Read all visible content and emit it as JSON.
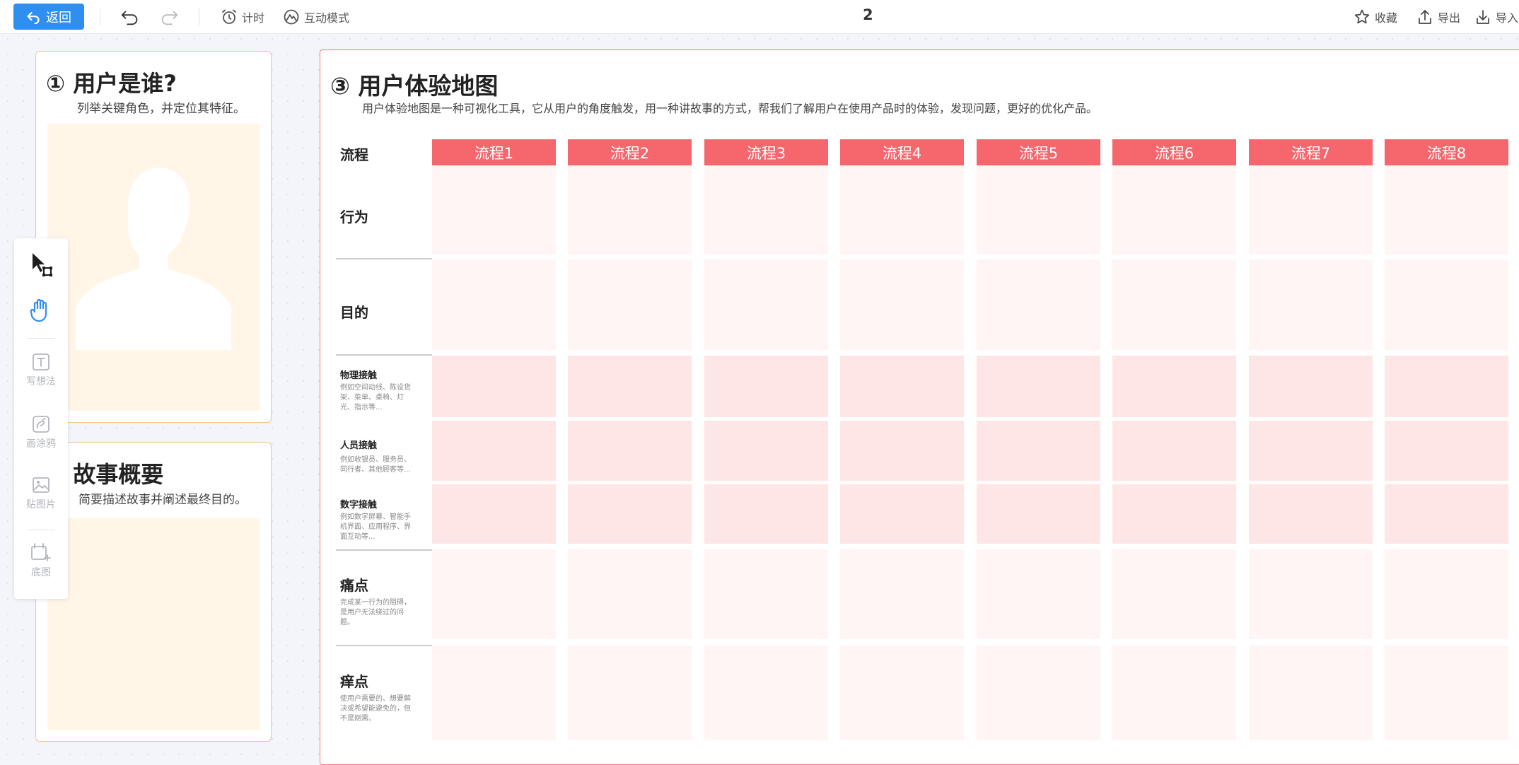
{
  "toolbar": {
    "back_label": "返回",
    "timer_label": "计时",
    "interactive_label": "互动模式",
    "page_number": "2",
    "favorite_label": "收藏",
    "export_label": "导出",
    "import_label": "导入"
  },
  "card_users": {
    "title": "① 用户是谁?",
    "subtitle": "列举关键角色，并定位其特征。"
  },
  "card_story": {
    "title": "② 故事概要",
    "subtitle": "简要描述故事并阐述最终目的。"
  },
  "palette": {
    "tools": [
      {
        "name": "select-tool",
        "label": ""
      },
      {
        "name": "hand-tool",
        "label": ""
      },
      {
        "name": "sticky-note-tool",
        "label": "写想法"
      },
      {
        "name": "doodle-tool",
        "label": "画涂鸦"
      },
      {
        "name": "image-tool",
        "label": "贴图片"
      },
      {
        "name": "background-tool",
        "label": "底图"
      }
    ]
  },
  "map": {
    "title": "③ 用户体验地图",
    "subtitle": "用户体验地图是一种可视化工具，它从用户的角度触发，用一种讲故事的方式，帮我们了解用户在使用产品时的体验，发现问题，更好的优化产品。",
    "process_label": "流程",
    "columns": [
      "流程1",
      "流程2",
      "流程3",
      "流程4",
      "流程5",
      "流程6",
      "流程7",
      "流程8"
    ],
    "rows": [
      {
        "label": "行为",
        "desc": ""
      },
      {
        "label": "目的",
        "desc": ""
      },
      {
        "label": "物理接触",
        "desc": "例如空间动线、陈设货架、菜单、桌椅、灯光、指示等..."
      },
      {
        "label": "人员接触",
        "desc": "例如收银员、服务员、同行者、其他顾客等..."
      },
      {
        "label": "数字接触",
        "desc": "例如数字屏幕、智能手机界面、应用程序、界面互动等..."
      },
      {
        "label": "痛点",
        "desc": "完成某一行为的阻碍，是用户无法绕过的问题。"
      },
      {
        "label": "痒点",
        "desc": "使用户需要的、想要解决或希望能避免的，但不是刚需。"
      }
    ]
  },
  "colors": {
    "accent_blue": "#2f8ff0",
    "card_border": "#f2c48a",
    "map_border": "#f07a7a",
    "column_header": "#f5666d"
  }
}
